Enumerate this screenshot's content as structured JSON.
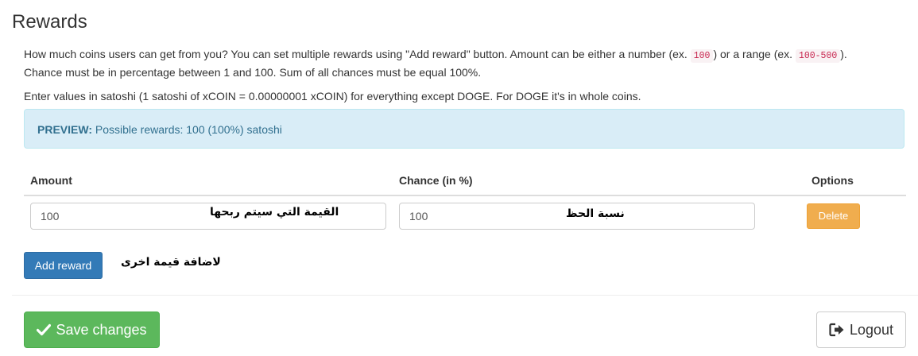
{
  "page": {
    "title": "Rewards"
  },
  "description": {
    "line1_a": "How much coins users can get from you? You can set multiple rewards using \"Add reward\" button. Amount can be either a number (ex. ",
    "code1": "100",
    "line1_b": ") or a range (ex. ",
    "code2": "100-500",
    "line1_c": ").",
    "line2": "Chance must be in percentage between 1 and 100. Sum of all chances must be equal 100%.",
    "line3": "Enter values in satoshi (1 satoshi of xCOIN = 0.00000001 xCOIN) for everything except DOGE. For DOGE it's in whole coins."
  },
  "preview": {
    "label": "PREVIEW:",
    "text": " Possible rewards: 100 (100%) satoshi"
  },
  "table": {
    "headers": {
      "amount": "Amount",
      "chance": "Chance (in %)",
      "options": "Options"
    },
    "row": {
      "amount_value": "100",
      "chance_value": "100",
      "delete_label": "Delete"
    }
  },
  "annotations": {
    "amount_note": "القيمة التي سيتم ربحها",
    "chance_note": "نسبة الحظ",
    "add_note": "لاضافة قيمة اخرى"
  },
  "buttons": {
    "add_reward": "Add reward",
    "save": "Save changes",
    "logout": "Logout"
  },
  "icons": {
    "save": "check-icon",
    "logout": "sign-out-icon"
  },
  "colors": {
    "primary": "#337ab7",
    "success": "#5cb85c",
    "warning": "#f0ad4e",
    "info_bg": "#d9edf7",
    "info_text": "#31708f"
  }
}
